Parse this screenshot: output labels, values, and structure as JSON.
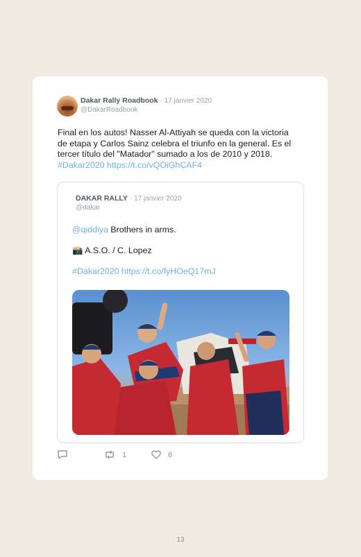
{
  "tweet": {
    "author_name": "Dakar Rally Roadbook",
    "separator": "·",
    "date": "17 janvier 2020",
    "handle": "@DakarRoadbook",
    "text": "Final en los autos! Nasser Al-Attiyah se queda con la victoria de etapa y Carlos Sainz celebra el triunfo en la general. Es el tercer título del \"Matador\" sumado a los de 2010 y 2018.",
    "hashtag": "#Dakar2020",
    "link": "https://t.co/vQOiGhCAF4"
  },
  "quoted": {
    "author_name": "DAKAR RALLY",
    "separator": "·",
    "date": "17 janvier 2020",
    "handle": "@dakar",
    "mention": "@qiddiya",
    "line1_text": "Brothers in arms.",
    "line2_text": "📸 A.S.O. / C. Lopez",
    "hashtag": "#Dakar2020",
    "link": "https://t.co/fyHOeQ17mJ"
  },
  "actions": {
    "reply_icon": "reply-icon",
    "retweet_icon": "retweet-icon",
    "retweet_count": "1",
    "like_icon": "heart-icon",
    "like_count": "6"
  },
  "page_number": "13",
  "colors": {
    "background": "#f1ebe1",
    "link": "#6db3dd",
    "muted": "#9aa3ab"
  }
}
